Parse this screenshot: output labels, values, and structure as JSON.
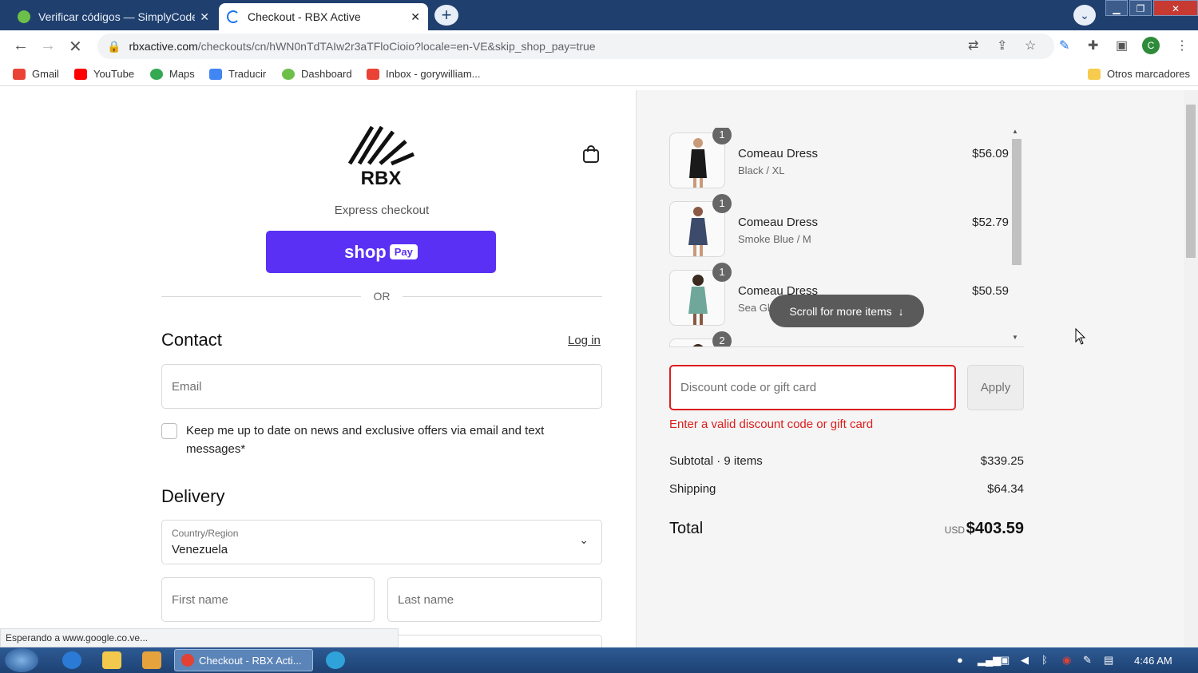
{
  "browser": {
    "tabs": [
      {
        "title": "Verificar códigos — SimplyCodes",
        "active": false
      },
      {
        "title": "Checkout - RBX Active",
        "active": true
      }
    ],
    "url_host": "rbxactive.com",
    "url_path": "/checkouts/cn/hWN0nTdTAIw2r3aTFloCioio?locale=en-VE&skip_shop_pay=true",
    "profile_initial": "C",
    "bookmarks": [
      "Gmail",
      "YouTube",
      "Maps",
      "Traducir",
      "Dashboard",
      "Inbox - gorywilliam...",
      "Otros marcadores"
    ],
    "status_text": "Esperando a www.google.co.ve..."
  },
  "checkout": {
    "brand": "RBX",
    "express_label": "Express checkout",
    "shoppay_label": "shop",
    "shoppay_pay": "Pay",
    "or_label": "OR",
    "contact_heading": "Contact",
    "login_link": "Log in",
    "email_placeholder": "Email",
    "newsletter_label": "Keep me up to date on news and exclusive offers via email and text messages*",
    "delivery_heading": "Delivery",
    "country_label": "Country/Region",
    "country_value": "Venezuela",
    "first_name_placeholder": "First name",
    "last_name_placeholder": "Last name"
  },
  "summary": {
    "items": [
      {
        "qty": "1",
        "name": "Comeau Dress",
        "variant": "Black / XL",
        "price": "$56.09",
        "color": "#1a1a1a"
      },
      {
        "qty": "1",
        "name": "Comeau Dress",
        "variant": "Smoke Blue / M",
        "price": "$52.79",
        "color": "#3c4a6b"
      },
      {
        "qty": "1",
        "name": "Comeau Dress",
        "variant": "Sea Gla",
        "price": "$50.59",
        "color": "#6fa79a"
      },
      {
        "qty": "2",
        "name": "",
        "variant": "",
        "price": "",
        "color": "#8a5a44"
      }
    ],
    "scroll_hint": "Scroll for more items",
    "discount_placeholder": "Discount code or gift card",
    "apply_label": "Apply",
    "error_text": "Enter a valid discount code or gift card",
    "subtotal_label": "Subtotal · 9 items",
    "subtotal_value": "$339.25",
    "shipping_label": "Shipping",
    "shipping_value": "$64.34",
    "total_label": "Total",
    "total_currency": "USD",
    "total_value": "$403.59"
  },
  "taskbar": {
    "active_task": "Checkout - RBX Acti...",
    "clock": "4:46 AM"
  },
  "colors": {
    "shoppay": "#5a31f4",
    "error": "#dd1d1d",
    "titlebar": "#1f3f6e"
  }
}
